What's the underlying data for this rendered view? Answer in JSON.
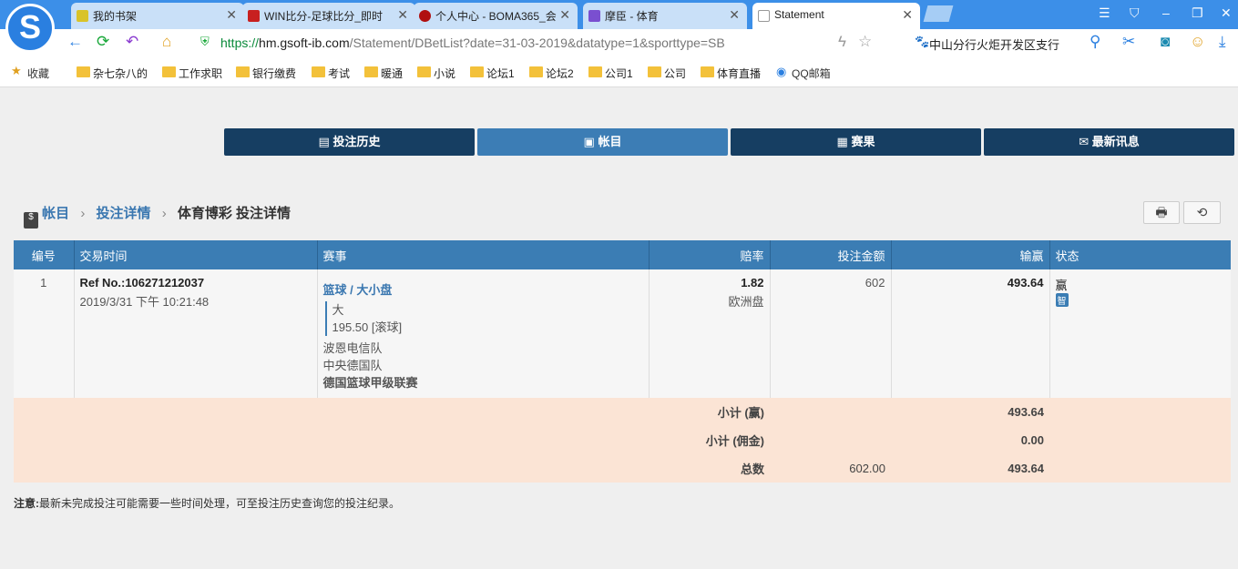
{
  "browser": {
    "tabs": [
      {
        "title": "我的书架",
        "color": "#d9c32a"
      },
      {
        "title": "WIN比分-足球比分_即时",
        "color": "#c82020"
      },
      {
        "title": "个人中心 - BOMA365_会",
        "color": "#b01010"
      },
      {
        "title": "摩臣 - 体育",
        "color": "#7a4fd0"
      },
      {
        "title": "Statement",
        "color": "#ffffff"
      }
    ],
    "url_scheme": "https://",
    "url_host": "hm.gsoft-ib.com",
    "url_path": "/Statement/DBetList?date=31-03-2019&datatype=1&sporttype=SB",
    "search_text": "中山分行火炬开发区支行",
    "bookmarks": [
      "收藏",
      "杂七杂八的",
      "工作求职",
      "银行缴费",
      "考试",
      "暖通",
      "小说",
      "论坛1",
      "论坛2",
      "公司1",
      "公司",
      "体育直播",
      "QQ邮箱"
    ]
  },
  "nav": [
    {
      "label": "投注历史"
    },
    {
      "label": "帐目"
    },
    {
      "label": "赛果"
    },
    {
      "label": "最新讯息"
    }
  ],
  "breadcrumb": {
    "root": "帐目",
    "mid": "投注详情",
    "current": "体育博彩 投注详情"
  },
  "table": {
    "headers": [
      "编号",
      "交易时间",
      "赛事",
      "赔率",
      "投注金额",
      "输赢",
      "状态"
    ],
    "row": {
      "no": "1",
      "ref": "Ref No.:106271212037",
      "time": "2019/3/31 下午 10:21:48",
      "sport": "篮球 / 大小盘",
      "pick": "大",
      "line": "195.50 [滚球]",
      "home": "波恩电信队",
      "away": "中央德国队",
      "league": "德国篮球甲级联赛",
      "odds": "1.82",
      "odds_type": "欧洲盘",
      "stake": "602",
      "winloss": "493.64",
      "status": "赢",
      "status_badge": "智"
    },
    "subtotals": [
      {
        "label": "小计 (赢)",
        "stake": "",
        "winloss": "493.64"
      },
      {
        "label": "小计 (佣金)",
        "stake": "",
        "winloss": "0.00"
      },
      {
        "label": "总数",
        "stake": "602.00",
        "winloss": "493.64"
      }
    ]
  },
  "note": {
    "label": "注意:",
    "text": "最新未完成投注可能需要一些时间处理，可至投注历史查询您的投注纪录。"
  }
}
